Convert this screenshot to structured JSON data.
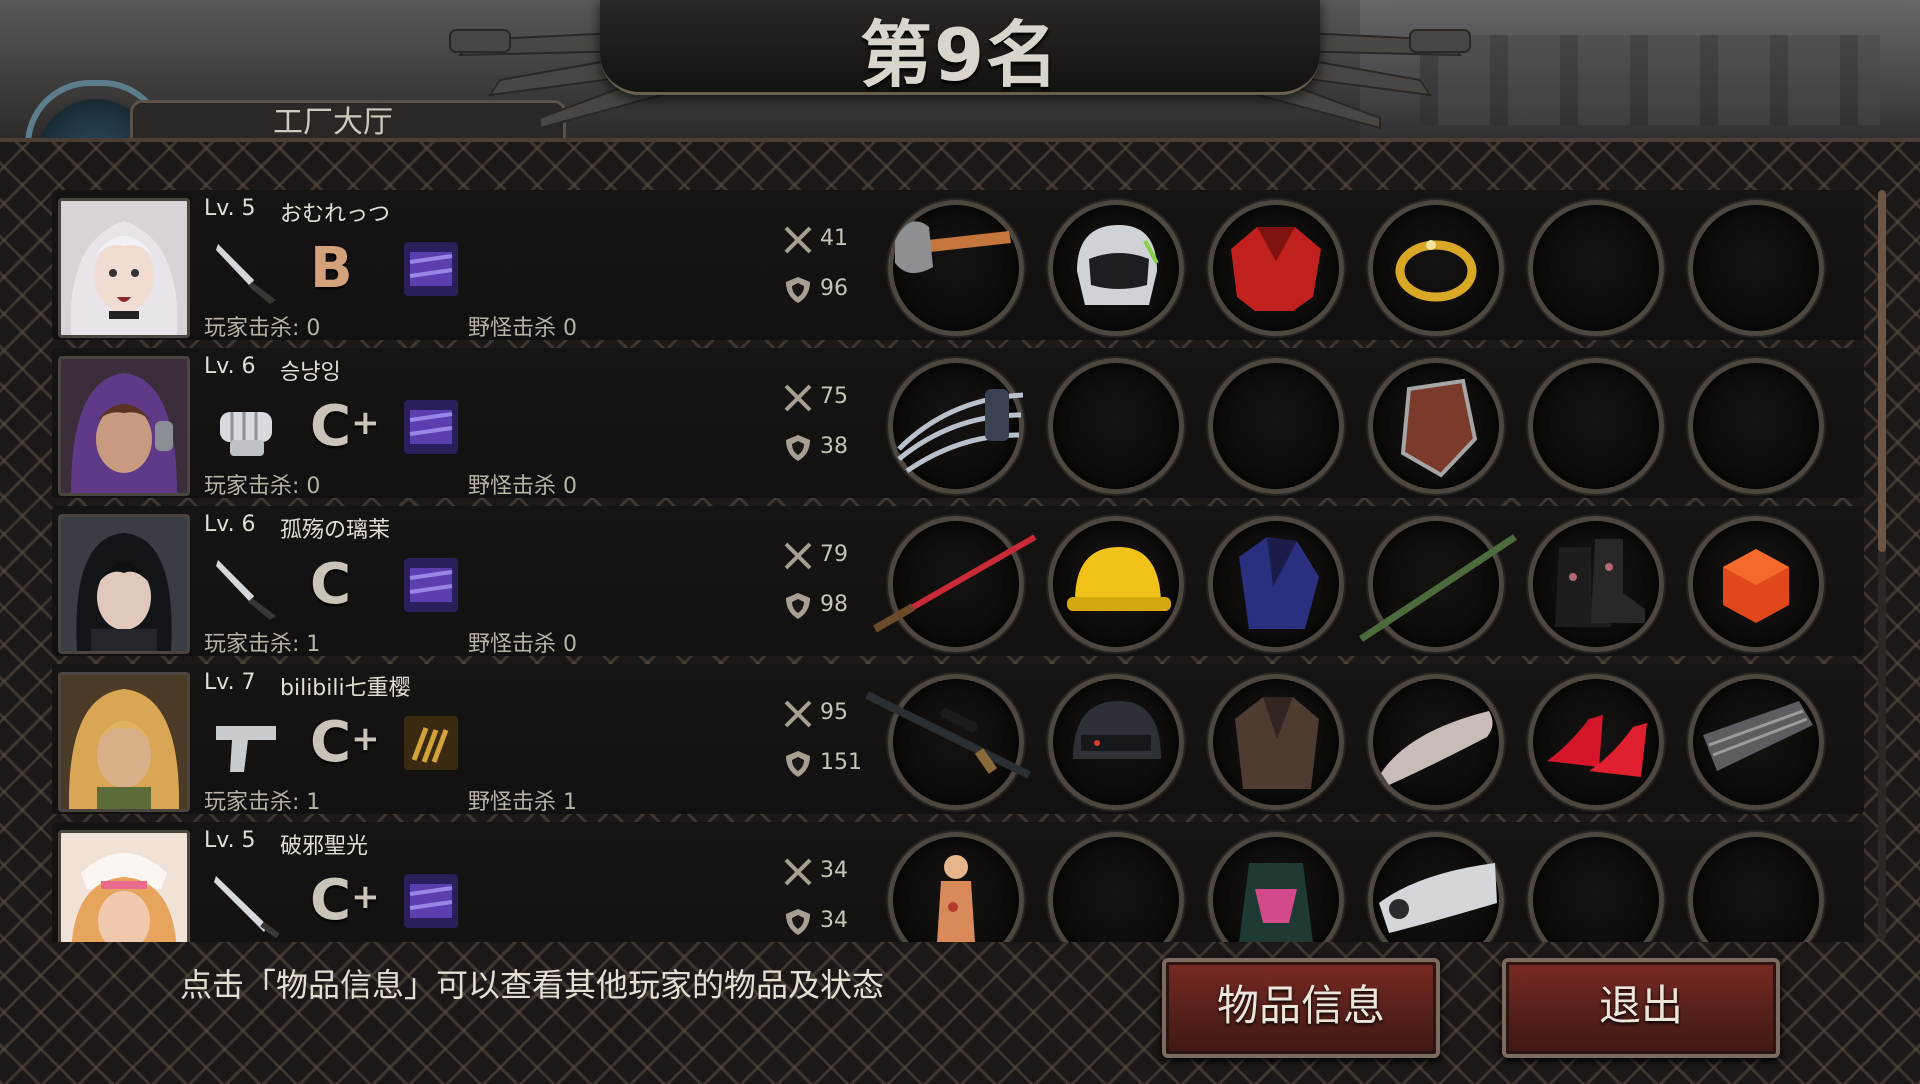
{
  "header": {
    "rank_title": "第9名",
    "location_text": "工厂大厅"
  },
  "players": [
    {
      "level": "Lv. 5",
      "name": "おむれっつ",
      "weapon": "knife-icon",
      "grade": "B",
      "grade_plus": "",
      "skill": "purple-skill-icon",
      "player_kills": "玩家击杀: 0",
      "monster_kills": "野怪击杀 0",
      "attack": "41",
      "defense": "96",
      "slots": [
        "axe-icon",
        "motorcycle-helmet-icon",
        "red-jacket-icon",
        "gold-bracelet-icon",
        "empty",
        "empty"
      ]
    },
    {
      "level": "Lv. 6",
      "name": "승냥잉",
      "weapon": "fist-icon",
      "grade": "C",
      "grade_plus": "+",
      "skill": "purple-skill-icon",
      "player_kills": "玩家击杀: 0",
      "monster_kills": "野怪击杀 0",
      "attack": "75",
      "defense": "38",
      "slots": [
        "claw-icon",
        "empty",
        "empty",
        "leather-armguard-icon",
        "empty",
        "empty"
      ]
    },
    {
      "level": "Lv. 6",
      "name": "孤殇の璃茉",
      "weapon": "knife-icon",
      "grade": "C",
      "grade_plus": "",
      "skill": "purple-skill-icon",
      "player_kills": "玩家击杀: 1",
      "monster_kills": "野怪击杀 0",
      "attack": "79",
      "defense": "98",
      "slots": [
        "red-katana-icon",
        "hard-hat-icon",
        "blue-jacket-icon",
        "bamboo-staff-icon",
        "floral-boots-icon",
        "red-dice-icon"
      ]
    },
    {
      "level": "Lv. 7",
      "name": "bilibili七重樱",
      "weapon": "pistol-icon",
      "grade": "C",
      "grade_plus": "+",
      "skill": "bullets-skill-icon",
      "player_kills": "玩家击杀: 1",
      "monster_kills": "野怪击杀 1",
      "attack": "95",
      "defense": "151",
      "slots": [
        "sniper-rifle-icon",
        "tactical-helmet-icon",
        "brown-coat-icon",
        "bullet-armguard-icon",
        "red-heels-icon",
        "steel-plate-icon"
      ]
    },
    {
      "level": "Lv. 5",
      "name": "破邪聖光",
      "weapon": "bat-icon",
      "grade": "C",
      "grade_plus": "+",
      "skill": "purple-skill-icon",
      "player_kills": "",
      "monster_kills": "",
      "attack": "34",
      "defense": "34",
      "slots": [
        "figurine-icon",
        "empty",
        "backpack-armor-icon",
        "cloth-armguard-icon",
        "empty",
        "empty"
      ]
    }
  ],
  "footer": {
    "hint": "点击「物品信息」可以查看其他玩家的物品及状态",
    "item_info_button": "物品信息",
    "exit_button": "退出"
  }
}
